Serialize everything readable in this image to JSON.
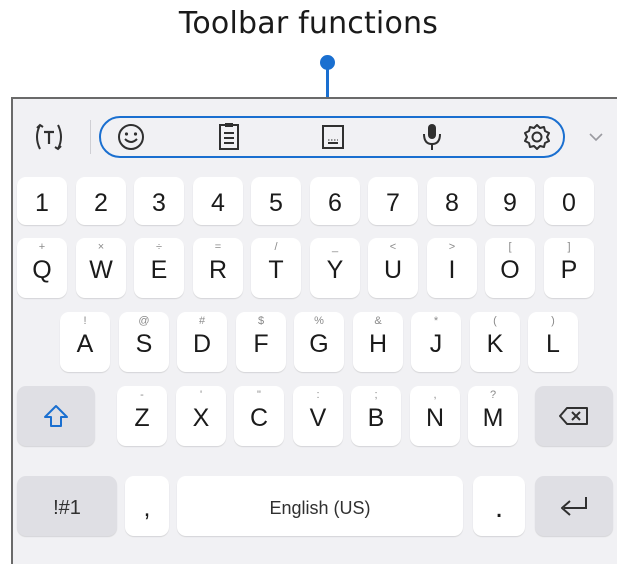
{
  "callout": {
    "title": "Toolbar functions"
  },
  "toolbar": {
    "icons": [
      "text-recognition-icon",
      "emoji-icon",
      "clipboard-icon",
      "keyboard-mode-icon",
      "microphone-icon",
      "settings-icon",
      "expand-chevron-icon"
    ],
    "highlight_color": "#1a6fd0"
  },
  "keyboard": {
    "numbers": [
      "1",
      "2",
      "3",
      "4",
      "5",
      "6",
      "7",
      "8",
      "9",
      "0"
    ],
    "row1": [
      {
        "key": "Q",
        "hint": "+"
      },
      {
        "key": "W",
        "hint": "×"
      },
      {
        "key": "E",
        "hint": "÷"
      },
      {
        "key": "R",
        "hint": "="
      },
      {
        "key": "T",
        "hint": "/"
      },
      {
        "key": "Y",
        "hint": "_"
      },
      {
        "key": "U",
        "hint": "<"
      },
      {
        "key": "I",
        "hint": ">"
      },
      {
        "key": "O",
        "hint": "["
      },
      {
        "key": "P",
        "hint": "]"
      }
    ],
    "row2": [
      {
        "key": "A",
        "hint": "!"
      },
      {
        "key": "S",
        "hint": "@"
      },
      {
        "key": "D",
        "hint": "#"
      },
      {
        "key": "F",
        "hint": "$"
      },
      {
        "key": "G",
        "hint": "%"
      },
      {
        "key": "H",
        "hint": "&"
      },
      {
        "key": "J",
        "hint": "*"
      },
      {
        "key": "K",
        "hint": "("
      },
      {
        "key": "L",
        "hint": ")"
      }
    ],
    "row3": [
      {
        "key": "Z",
        "hint": "-"
      },
      {
        "key": "X",
        "hint": "'"
      },
      {
        "key": "C",
        "hint": "\""
      },
      {
        "key": "V",
        "hint": ":"
      },
      {
        "key": "B",
        "hint": ";"
      },
      {
        "key": "N",
        "hint": ","
      },
      {
        "key": "M",
        "hint": "?"
      }
    ],
    "symbols_label": "!#1",
    "comma_label": ",",
    "space_label": "English (US)",
    "period_label": "."
  }
}
